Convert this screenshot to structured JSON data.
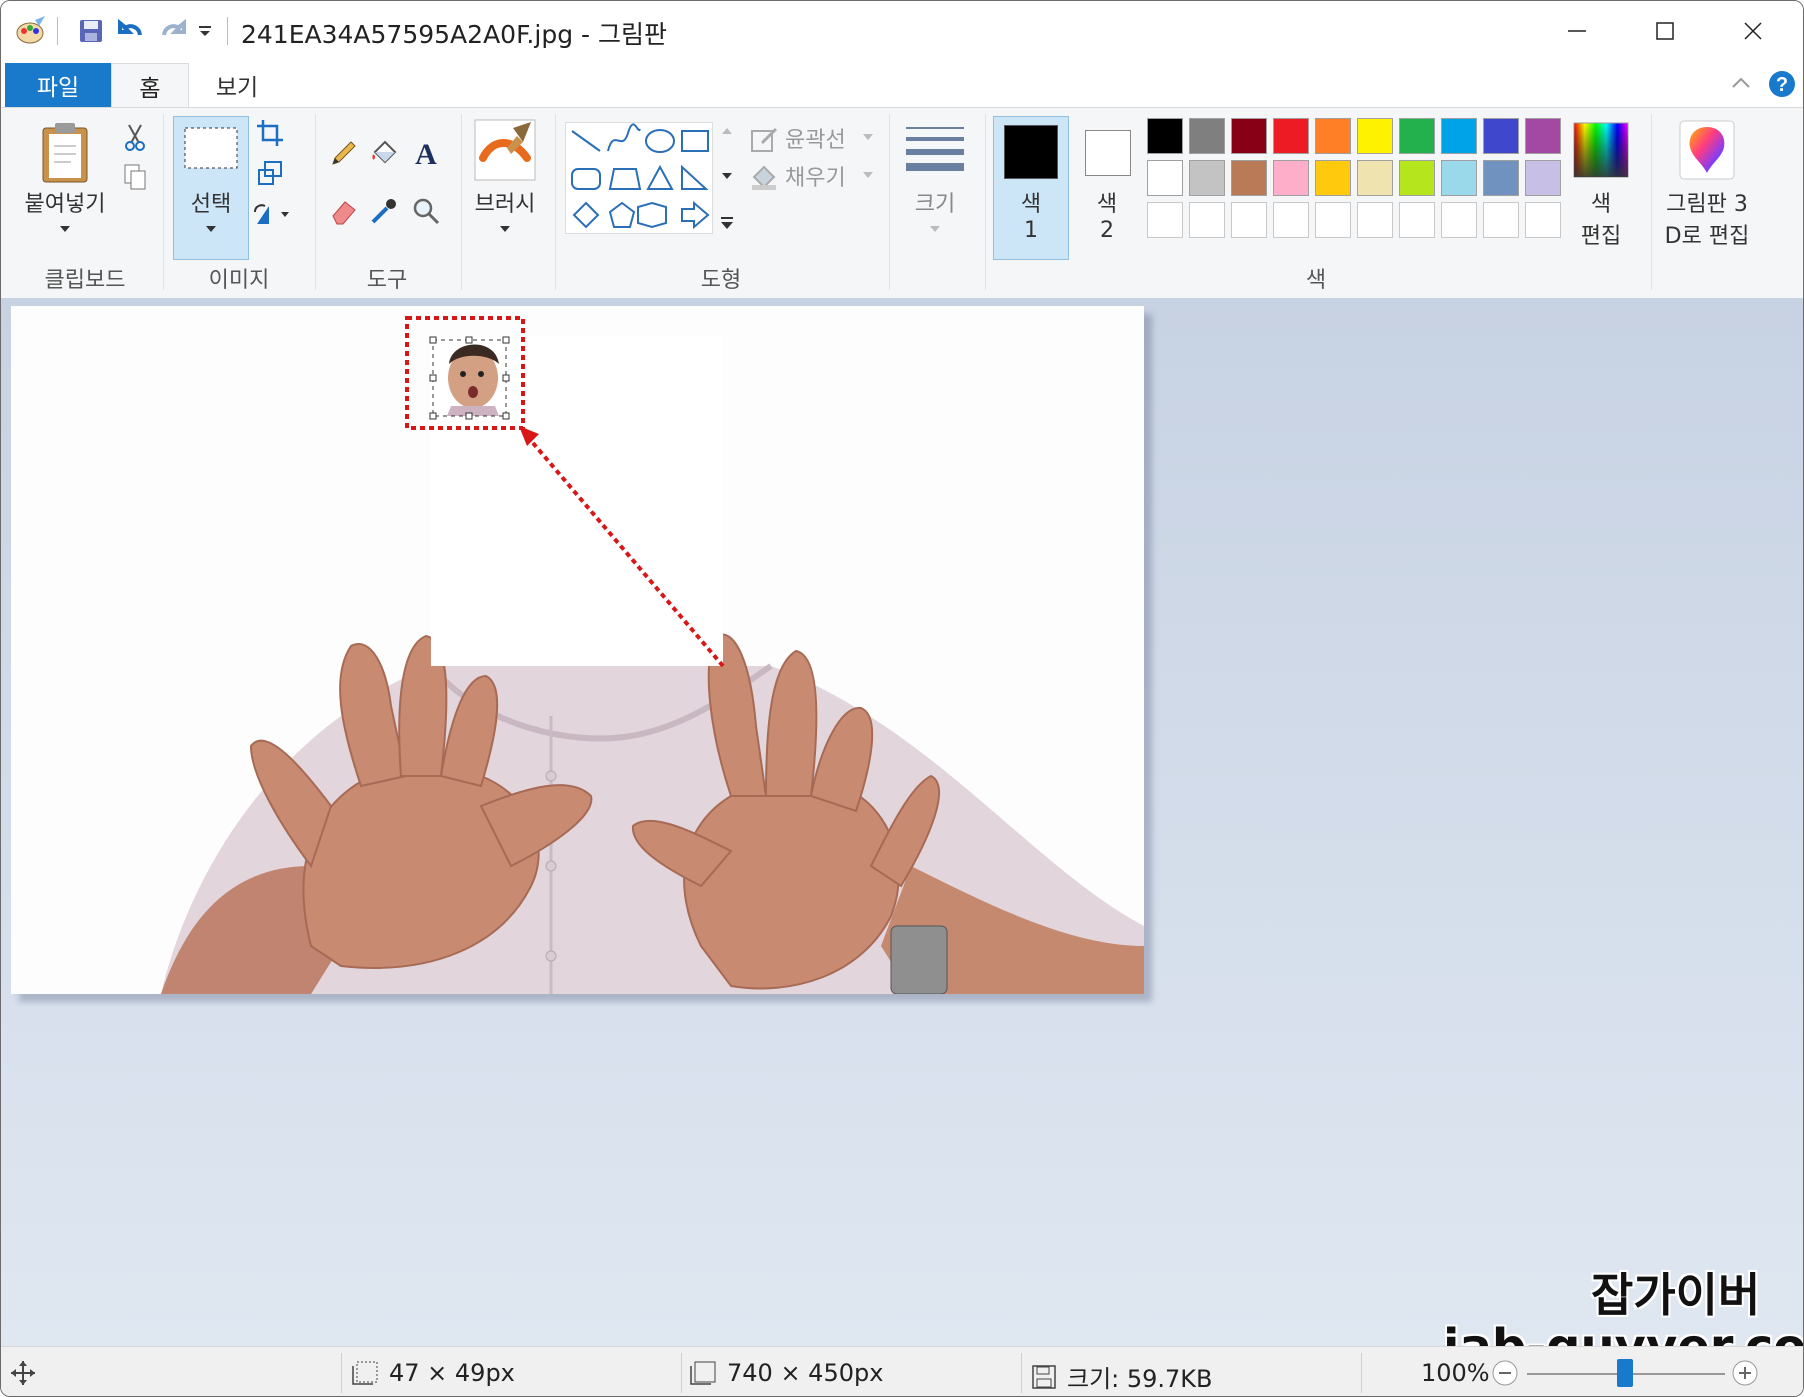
{
  "window": {
    "title": "241EA34A57595A2A0F.jpg - 그림판",
    "icons": [
      "paint-app-icon",
      "save-icon",
      "undo-icon",
      "redo-icon",
      "customize-quick-access-icon"
    ],
    "controls": [
      "minimize-icon",
      "maximize-icon",
      "close-icon"
    ]
  },
  "tabs": {
    "file": "파일",
    "home": "홈",
    "view": "보기"
  },
  "ribbon": {
    "clipboard": {
      "paste": "붙여넣기",
      "group": "클립보드"
    },
    "image": {
      "select": "선택",
      "group": "이미지"
    },
    "tools": {
      "group": "도구"
    },
    "brushes": {
      "label": "브러시"
    },
    "shapes": {
      "outline": "윤곽선",
      "fill": "채우기",
      "group": "도형"
    },
    "size": {
      "label": "크기"
    },
    "colors": {
      "color1_a": "색",
      "color1_b": "1",
      "color2_a": "색",
      "color2_b": "2",
      "edit_a": "색",
      "edit_b": "편집",
      "paint3d_a": "그림판 3",
      "paint3d_b": "D로 편집",
      "group": "색",
      "color1_value": "#000000",
      "color2_value": "#ffffff",
      "palette_row1": [
        "#000000",
        "#7f7f7f",
        "#880015",
        "#ed1c24",
        "#ff7f27",
        "#fff200",
        "#22b14c",
        "#00a2e8",
        "#3f48cc",
        "#a349a4"
      ],
      "palette_row2": [
        "#ffffff",
        "#c3c3c3",
        "#b97a57",
        "#ffaec9",
        "#ffc90e",
        "#efe4b0",
        "#b5e61d",
        "#99d9ea",
        "#7092be",
        "#c8bfe7"
      ]
    }
  },
  "status": {
    "selection_size": "47 × 49px",
    "image_size": "740 × 450px",
    "file_size": "크기: 59.7KB",
    "zoom": "100%"
  },
  "watermark": {
    "line1": "잡가이버",
    "line2": "jab-guyver.co.kr"
  }
}
